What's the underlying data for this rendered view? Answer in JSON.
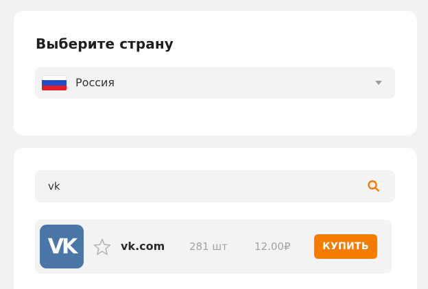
{
  "country_section": {
    "title": "Выберите страну",
    "selected_country": "Россия",
    "flag_icon": "russia-flag-icon",
    "dropdown_icon": "caret-down-icon"
  },
  "search": {
    "value": "vk",
    "icon": "search-icon",
    "icon_color": "#f57c00"
  },
  "results": [
    {
      "logo_icon": "vk-logo-icon",
      "logo_text": "VK",
      "favorite_icon": "star-outline-icon",
      "service": "vk.com",
      "count": "281 шт",
      "price": "12.00₽",
      "buy_label": "КУПИТЬ"
    }
  ],
  "colors": {
    "accent": "#f57c00",
    "vk_brand": "#4a76a8",
    "background": "#f2f2f2",
    "card": "#ffffff",
    "field": "#f3f3f3"
  }
}
